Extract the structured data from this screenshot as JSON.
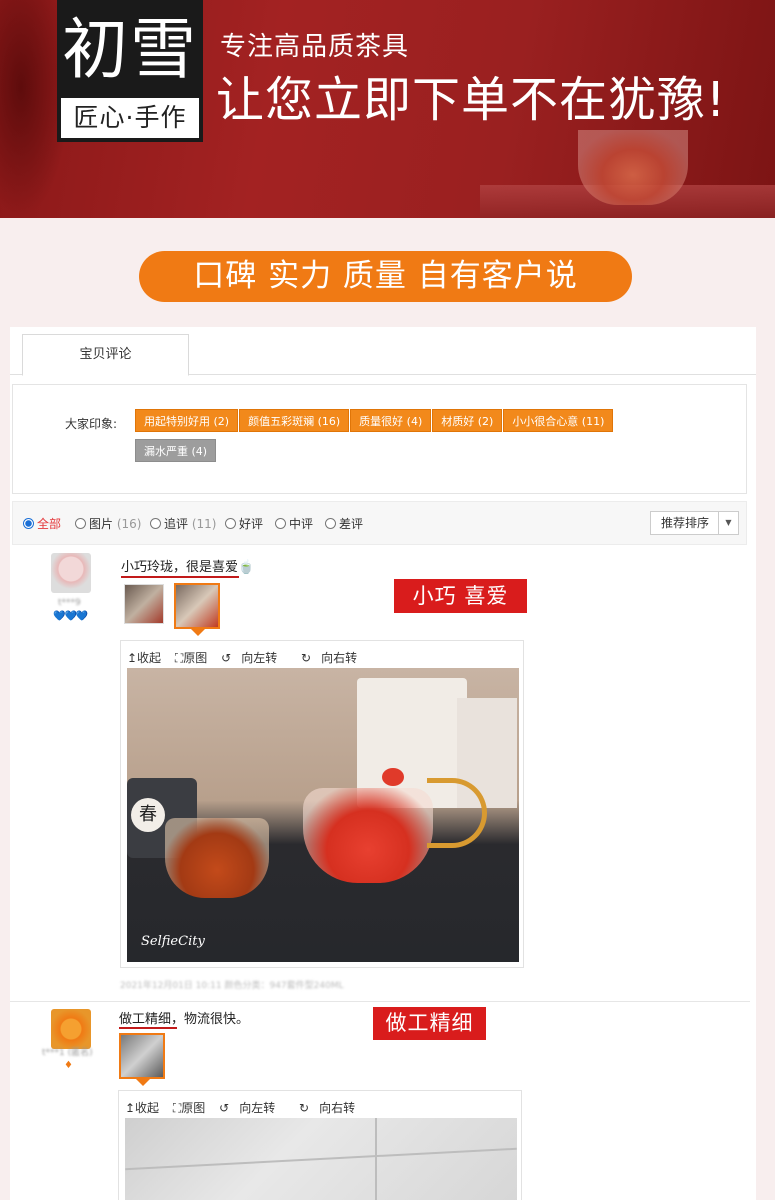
{
  "banner": {
    "logo_main": "初雪",
    "logo_sub": "匠心·手作",
    "tagline_small": "专注高品质茶具",
    "tagline_large": "让您立即下单不在犹豫!"
  },
  "slogan": "口碑 实力 质量 自有客户说",
  "reviews_panel": {
    "tab_label": "宝贝评论",
    "impressions_label": "大家印象:",
    "tags": [
      {
        "text": "用起特别好用 (2)",
        "style": "orange"
      },
      {
        "text": "颜值五彩斑斓 (16)",
        "style": "orange"
      },
      {
        "text": "质量很好 (4)",
        "style": "orange"
      },
      {
        "text": "材质好 (2)",
        "style": "orange"
      },
      {
        "text": "小小很合心意 (11)",
        "style": "orange"
      },
      {
        "text": "漏水严重 (4)",
        "style": "gray"
      }
    ],
    "filters": [
      {
        "label": "全部",
        "count": "",
        "selected": true
      },
      {
        "label": "图片",
        "count": "(16)",
        "selected": false
      },
      {
        "label": "追评",
        "count": "(11)",
        "selected": false
      },
      {
        "label": "好评",
        "count": "",
        "selected": false
      },
      {
        "label": "中评",
        "count": "",
        "selected": false
      },
      {
        "label": "差评",
        "count": "",
        "selected": false
      }
    ],
    "sort_label": "推荐排序"
  },
  "viewer_toolbar": {
    "collapse": "↥收起",
    "original": "⛶原图",
    "rotate_left": "向左转",
    "rotate_right": "向右转"
  },
  "reviews": [
    {
      "username": "t***9",
      "rank": "💙💙💙",
      "text": "小巧玲珑，很是喜爱🍵",
      "annotation": "小巧  喜爱",
      "photo_watermark": "SelfieCity",
      "photo_tag": "春",
      "meta": "2021年12月01日 10:11      颜色分类：947套件型240ML"
    },
    {
      "username": "t***1 (匿名)",
      "rank": "♦",
      "text": "做工精细，物流很快。",
      "annotation": "做工精细"
    }
  ],
  "colors": {
    "banner_red": "#9e2020",
    "accent_orange": "#f07a14",
    "tag_orange": "#f2891b",
    "annotation_red": "#d91c1c"
  }
}
